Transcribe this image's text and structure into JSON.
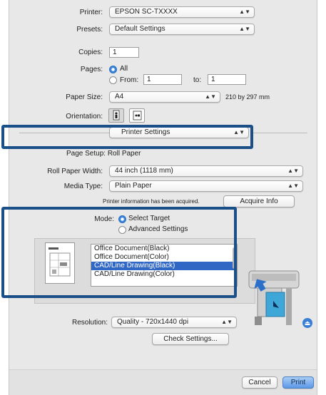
{
  "printer": {
    "label": "Printer:",
    "value": "EPSON SC-TXXXX"
  },
  "presets": {
    "label": "Presets:",
    "value": "Default Settings"
  },
  "copies": {
    "label": "Copies:",
    "value": "1"
  },
  "pages": {
    "label": "Pages:",
    "all_label": "All",
    "from_label": "From:",
    "from_value": "1",
    "to_label": "to:",
    "to_value": "1",
    "selected": "All"
  },
  "paper_size": {
    "label": "Paper Size:",
    "value": "A4",
    "dimensions": "210 by 297 mm"
  },
  "orientation": {
    "label": "Orientation:",
    "selected": "portrait"
  },
  "section": {
    "value": "Printer Settings"
  },
  "page_setup": {
    "text": "Page Setup: Roll Paper"
  },
  "roll_paper_width": {
    "label": "Roll Paper Width:",
    "value": "44 inch (1118 mm)"
  },
  "media_type": {
    "label": "Media Type:",
    "value": "Plain Paper"
  },
  "printer_info": {
    "message": "Printer information has been acquired.",
    "button": "Acquire Info"
  },
  "mode": {
    "label": "Mode:",
    "option_select": "Select Target",
    "option_advanced": "Advanced Settings",
    "selected": "Select Target"
  },
  "targets": {
    "items": [
      "Office Document(Black)",
      "Office Document(Color)",
      "CAD/Line Drawing(Black)",
      "CAD/Line Drawing(Color)"
    ],
    "selected_index": 2
  },
  "resolution": {
    "label": "Resolution:",
    "value": "Quality - 720x1440 dpi"
  },
  "check_settings": {
    "label": "Check Settings..."
  },
  "footer": {
    "cancel": "Cancel",
    "print": "Print"
  },
  "colors": {
    "callout": "#1a4f88",
    "selection": "#3167c4",
    "print_button": "#6fa6ea"
  },
  "icons": {
    "preview": "document-preview-icon",
    "printer": "large-format-printer-icon",
    "eject": "eject-icon"
  }
}
